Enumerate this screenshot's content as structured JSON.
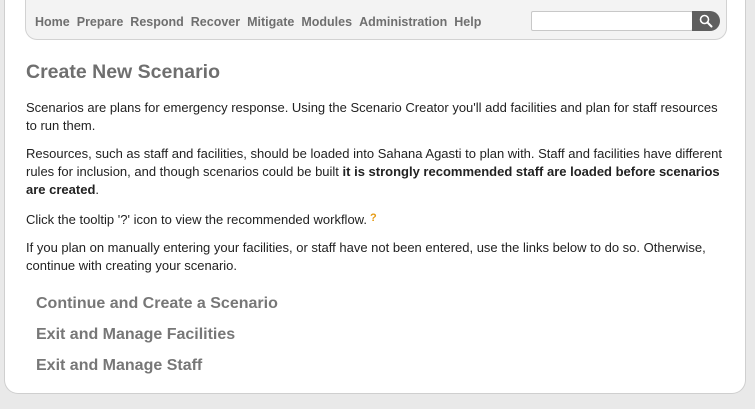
{
  "nav": {
    "items": [
      {
        "label": "Home"
      },
      {
        "label": "Prepare"
      },
      {
        "label": "Respond"
      },
      {
        "label": "Recover"
      },
      {
        "label": "Mitigate"
      },
      {
        "label": "Modules"
      },
      {
        "label": "Administration"
      },
      {
        "label": "Help"
      }
    ],
    "search": {
      "value": "",
      "placeholder": ""
    }
  },
  "main": {
    "title": "Create New Scenario",
    "para1": "Scenarios are plans for emergency response. Using the Scenario Creator you'll add facilities and plan for staff resources to run them.",
    "para2_normal": "Resources, such as staff and facilities, should be loaded into Sahana Agasti to plan with. Staff and facilities have different rules for inclusion, and though scenarios could be built ",
    "para2_bold": "it is strongly recommended staff are loaded before scenarios are created",
    "para2_end": ".",
    "para3": "Click the tooltip '?' icon to view the recommended workflow.",
    "tooltip_icon": "?",
    "para4": "If you plan on manually entering your facilities, or staff have not been entered, use the links below to do so. Otherwise, continue with creating your scenario.",
    "links": [
      {
        "label": "Continue and Create a Scenario"
      },
      {
        "label": "Exit and Manage Facilities"
      },
      {
        "label": "Exit and Manage Staff"
      }
    ]
  },
  "colors": {
    "nav_text": "#6f6f6f",
    "tooltip": "#e59a12",
    "link": "#777777",
    "search_button": "#5f5f5f"
  }
}
